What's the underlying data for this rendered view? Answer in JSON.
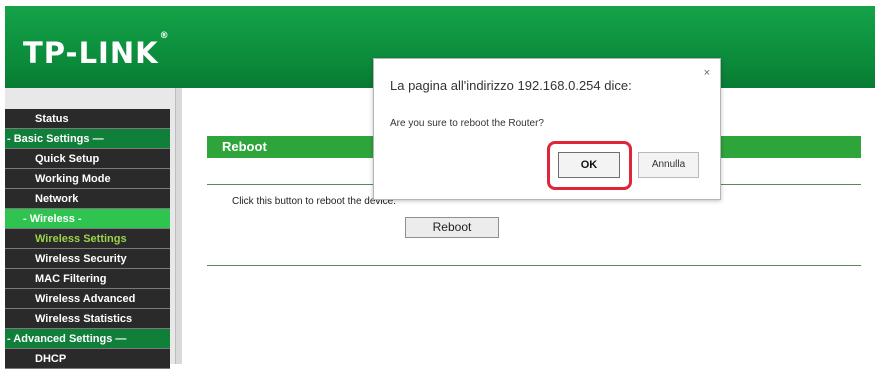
{
  "brand": {
    "logo_text": "TP-LINK",
    "logo_mark": "®"
  },
  "sidebar": {
    "items": [
      {
        "label": "Status",
        "kind": "top"
      },
      {
        "label": "- Basic Settings —",
        "kind": "section"
      },
      {
        "label": "Quick Setup",
        "kind": "level1"
      },
      {
        "label": "Working Mode",
        "kind": "level1"
      },
      {
        "label": "Network",
        "kind": "level1"
      },
      {
        "label": "- Wireless -",
        "kind": "active"
      },
      {
        "label": "Wireless Settings",
        "kind": "current"
      },
      {
        "label": "Wireless Security",
        "kind": "sub"
      },
      {
        "label": "MAC Filtering",
        "kind": "sub"
      },
      {
        "label": "Wireless Advanced",
        "kind": "sub"
      },
      {
        "label": "Wireless Statistics",
        "kind": "sub"
      },
      {
        "label": "- Advanced Settings —",
        "kind": "section"
      },
      {
        "label": "DHCP",
        "kind": "level1"
      }
    ]
  },
  "main": {
    "section_title": "Reboot",
    "hint": "Click this button to reboot the device.",
    "reboot_button": "Reboot"
  },
  "dialog": {
    "title": "La pagina all'indirizzo 192.168.0.254 dice:",
    "close": "×",
    "message": "Are you sure to reboot the Router?",
    "ok": "OK",
    "cancel": "Annulla",
    "highlight_color": "#e0253a"
  },
  "colors": {
    "header": "#0b8a3a",
    "section_bar": "#2ea53b",
    "sidebar_bg": "#2a2a2a",
    "sidebar_active": "#2fc44f",
    "sidebar_current_text": "#9bd34a"
  }
}
